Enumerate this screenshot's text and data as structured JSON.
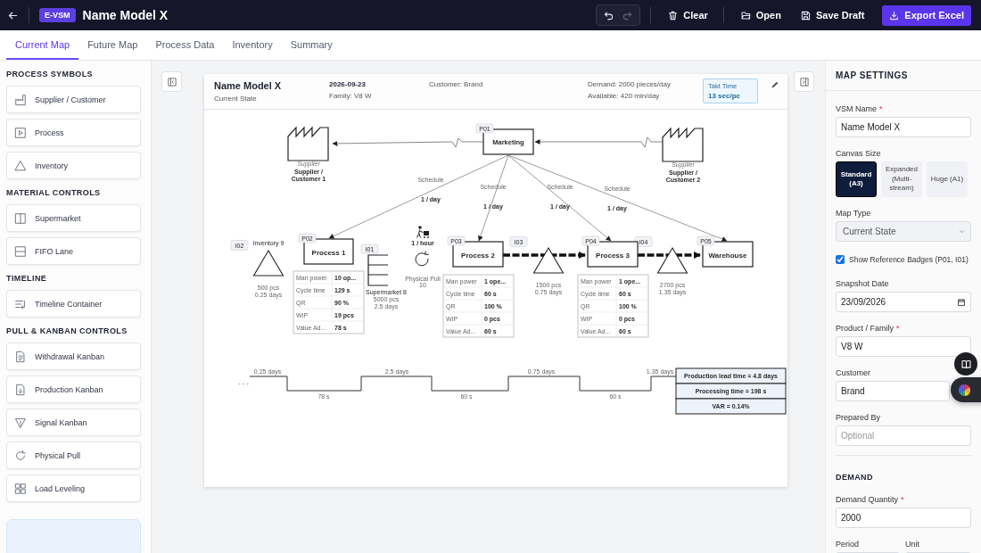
{
  "topbar": {
    "logo": "E-VSM",
    "title": "Name Model X",
    "undo_disabled": false,
    "redo_disabled": true,
    "buttons": [
      {
        "kind": "clear",
        "label": "Clear"
      },
      {
        "kind": "open",
        "label": "Open"
      },
      {
        "kind": "save",
        "label": "Save Draft"
      },
      {
        "kind": "export",
        "label": "Export Excel"
      }
    ]
  },
  "tabs": [
    {
      "label": "Current Map",
      "selected": true
    },
    {
      "label": "Future Map",
      "selected": false
    },
    {
      "label": "Process Data",
      "selected": false
    },
    {
      "label": "Inventory",
      "selected": false
    },
    {
      "label": "Summary",
      "selected": false
    }
  ],
  "sidebar": [
    {
      "title": "PROCESS SYMBOLS",
      "items": [
        {
          "kind": "factory",
          "label": "Supplier / Customer"
        },
        {
          "kind": "process",
          "label": "Process"
        },
        {
          "kind": "inventory",
          "label": "Inventory"
        }
      ]
    },
    {
      "title": "MATERIAL CONTROLS",
      "items": [
        {
          "kind": "supermarket",
          "label": "Supermarket"
        },
        {
          "kind": "fifo",
          "label": "FIFO Lane"
        }
      ]
    },
    {
      "title": "TIMELINE",
      "items": [
        {
          "kind": "timeline",
          "label": "Timeline Container"
        }
      ]
    },
    {
      "title": "PULL & KANBAN CONTROLS",
      "items": [
        {
          "kind": "withdrawal",
          "label": "Withdrawal Kanban"
        },
        {
          "kind": "production",
          "label": "Production Kanban"
        },
        {
          "kind": "signal",
          "label": "Signal Kanban"
        },
        {
          "kind": "pull",
          "label": "Physical Pull"
        },
        {
          "kind": "leveling",
          "label": "Load Leveling"
        }
      ]
    }
  ],
  "map": {
    "title": "Name Model X",
    "state": "Current State",
    "date": "2026-09-23",
    "family": "Family: V8 W",
    "customer": "Customer: Brand",
    "demand": "Demand: 2000 pieces/day",
    "available": "Available: 420 min/day",
    "takt": {
      "label": "Takt Time",
      "value": "13 sec/pc"
    },
    "suppliers": [
      {
        "type": "Supplier",
        "name_lines": [
          "Supplier /",
          "Customer 1"
        ]
      },
      {
        "type": "Supplier",
        "name_lines": [
          "Supplier /",
          "Customer 2"
        ]
      }
    ],
    "control": {
      "badge": "P01",
      "name": "Marketing"
    },
    "schedules": [
      {
        "label": "Schedule",
        "frequency": "1 / day"
      },
      {
        "label": "Schedule",
        "frequency": "1 / day"
      },
      {
        "label": "Schedule",
        "frequency": "1 / day"
      },
      {
        "label": "Schedule",
        "frequency": "1 / day"
      }
    ],
    "processes": [
      {
        "badge": "P02",
        "name": "Process 1",
        "data": [
          [
            "Man power",
            "10 op..."
          ],
          [
            "Cycle time",
            "129 s"
          ],
          [
            "QR",
            "90 %"
          ],
          [
            "WIP",
            "19 pcs"
          ],
          [
            "Value Ad...",
            "78 s"
          ]
        ]
      },
      {
        "badge": "P03",
        "name": "Process 2",
        "data": [
          [
            "Man power",
            "1 ope..."
          ],
          [
            "Cycle time",
            "60 s"
          ],
          [
            "QR",
            "100 %"
          ],
          [
            "WIP",
            "0 pcs"
          ],
          [
            "Value Ad...",
            "60 s"
          ]
        ]
      },
      {
        "badge": "P04",
        "name": "Process 3",
        "data": [
          [
            "Man power",
            "1 ope..."
          ],
          [
            "Cycle time",
            "60 s"
          ],
          [
            "QR",
            "100 %"
          ],
          [
            "WIP",
            "0 pcs"
          ],
          [
            "Value Ad...",
            "60 s"
          ]
        ]
      },
      {
        "badge": "P05",
        "name": "Warehouse"
      }
    ],
    "inventories": [
      {
        "badge": "I02",
        "name": "Inventory 9",
        "qty": "500 pcs",
        "days": "0.25 days"
      },
      {
        "badge": "I03",
        "qty": "1500 pcs",
        "days": "0.75 days"
      },
      {
        "badge": "I04",
        "qty": "2700 pcs",
        "days": "1.35 days"
      }
    ],
    "supermarket": {
      "badge": "I01",
      "name": "Supermarket 8",
      "qty": "5000 pcs",
      "days": "2.5 days"
    },
    "physical_pull": {
      "frequency": "1 / hour",
      "name": "Physical Pull",
      "qty": "10"
    },
    "timeline": {
      "lead": "- - -",
      "waits": [
        "0.25 days",
        "2.5 days",
        "0.75 days",
        "1.35 days"
      ],
      "cycles": [
        "78 s",
        "60 s",
        "60 s"
      ],
      "summary": [
        "Production lead time = 4.8 days",
        "Processing time = 198 s",
        "VAR = 0.14%"
      ]
    }
  },
  "settings": {
    "title": "MAP SETTINGS",
    "fields": [
      {
        "kind": "text",
        "label": "VSM Name",
        "required_mark": "*",
        "value": "Name Model X"
      },
      {
        "kind": "segmented",
        "label": "Canvas Size",
        "options": [
          {
            "label": "Standard (A3)",
            "selected": true
          },
          {
            "label": "Expanded (Multi-stream)",
            "selected": false
          },
          {
            "label": "Huge (A1)",
            "selected": false
          }
        ]
      },
      {
        "kind": "select",
        "label": "Map Type",
        "value": "Current State"
      },
      {
        "kind": "checkbox",
        "label": "Show Reference Badges (P01, I01)",
        "checked": true
      },
      {
        "kind": "date",
        "label": "Snapshot Date",
        "value": "23/09/2026"
      },
      {
        "kind": "text",
        "label": "Product / Family",
        "required_mark": "*",
        "value": "V8 W"
      },
      {
        "kind": "text",
        "label": "Customer",
        "value": "Brand"
      },
      {
        "kind": "text",
        "label": "Prepared By",
        "placeholder": "Optional"
      },
      {
        "kind": "section",
        "label": "DEMAND"
      },
      {
        "kind": "text",
        "label": "Demand Quantity",
        "required_mark": "*",
        "value": "2000"
      },
      {
        "kind": "pair",
        "labels": [
          "Period",
          "Unit"
        ]
      }
    ]
  }
}
